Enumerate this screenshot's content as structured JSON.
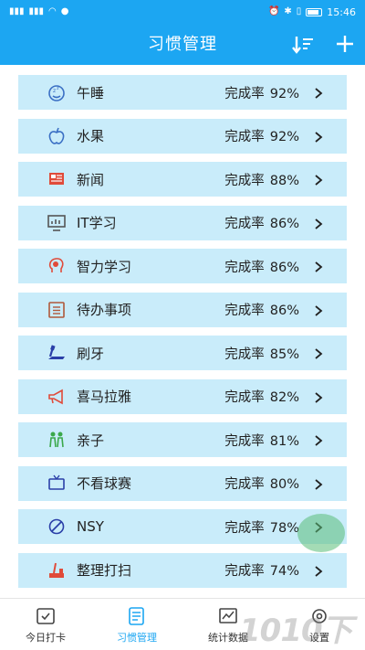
{
  "status_bar": {
    "time": "15:46",
    "battery": "82"
  },
  "app_bar": {
    "title": "习惯管理",
    "sort_icon": "sort-icon",
    "add_icon": "plus-icon"
  },
  "rate_label": "完成率",
  "habits": [
    {
      "name": "午睡",
      "rate": "92%",
      "icon": "nap-icon",
      "color": "#3a6fc4"
    },
    {
      "name": "水果",
      "rate": "92%",
      "icon": "apple-icon",
      "color": "#3a6fc4"
    },
    {
      "name": "新闻",
      "rate": "88%",
      "icon": "newspaper-icon",
      "color": "#e04b3a"
    },
    {
      "name": "IT学习",
      "rate": "86%",
      "icon": "monitor-icon",
      "color": "#555555"
    },
    {
      "name": "智力学习",
      "rate": "86%",
      "icon": "brain-icon",
      "color": "#e04b3a"
    },
    {
      "name": "待办事项",
      "rate": "86%",
      "icon": "checklist-icon",
      "color": "#b0583a"
    },
    {
      "name": "刷牙",
      "rate": "85%",
      "icon": "toothbrush-icon",
      "color": "#2a3fa8"
    },
    {
      "name": "喜马拉雅",
      "rate": "82%",
      "icon": "megaphone-icon",
      "color": "#e04b3a"
    },
    {
      "name": "亲子",
      "rate": "81%",
      "icon": "family-icon",
      "color": "#3aa84a"
    },
    {
      "name": "不看球赛",
      "rate": "80%",
      "icon": "tv-icon",
      "color": "#2a3fa8"
    },
    {
      "name": "NSY",
      "rate": "78%",
      "icon": "no-sign-icon",
      "color": "#2a3fa8"
    },
    {
      "name": "整理打扫",
      "rate": "74%",
      "icon": "cleaning-icon",
      "color": "#e04b3a"
    }
  ],
  "bottom_nav": [
    {
      "label": "今日打卡",
      "icon": "checkin-icon"
    },
    {
      "label": "习惯管理",
      "icon": "habit-manage-icon"
    },
    {
      "label": "统计数据",
      "icon": "statistics-icon"
    },
    {
      "label": "设置",
      "icon": "settings-icon"
    }
  ],
  "colors": {
    "accent": "#1ca6f2",
    "row_background": "#c9ecfa"
  },
  "watermark": "1010下"
}
